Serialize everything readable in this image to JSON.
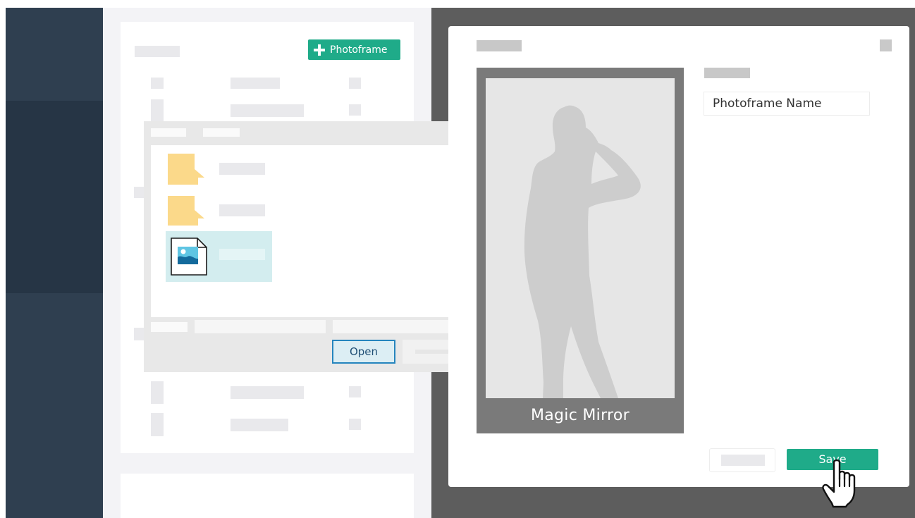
{
  "main": {
    "add_button_label": "Photoframe"
  },
  "file_dialog": {
    "open_label": "Open"
  },
  "modal": {
    "frame_brand": "Magic Mirror",
    "name_value": "Photoframe Name",
    "save_label": "Save"
  },
  "colors": {
    "accent": "#1fab89",
    "sidebar": "#2f3f50",
    "overlay": "#5d5d5d"
  },
  "icons": [
    "plus-icon",
    "folder-icon",
    "image-file-icon",
    "close-icon",
    "hand-pointer-icon"
  ]
}
